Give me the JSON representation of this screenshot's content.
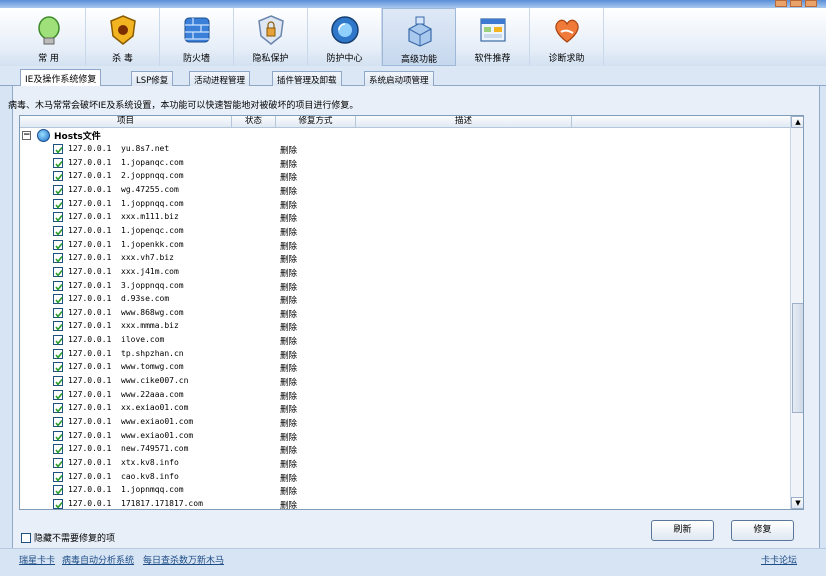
{
  "toolbar": {
    "items": [
      {
        "label": "常  用",
        "icon": "bulb-icon"
      },
      {
        "label": "杀  毒",
        "icon": "shield-bug-icon"
      },
      {
        "label": "防火墙",
        "icon": "firewall-icon"
      },
      {
        "label": "隐私保护",
        "icon": "lock-shield-icon"
      },
      {
        "label": "防护中心",
        "icon": "protection-globe-icon"
      },
      {
        "label": "高级功能",
        "icon": "advanced-blocks-icon"
      },
      {
        "label": "软件推荐",
        "icon": "software-window-icon"
      },
      {
        "label": "诊断求助",
        "icon": "heart-help-icon"
      }
    ],
    "active_index": 5
  },
  "tabs": [
    "IE及操作系统修复",
    "LSP修复",
    "活动进程管理",
    "插件管理及卸载",
    "系统启动项管理"
  ],
  "active_tab": 0,
  "description": "病毒、木马常常会破坏IE及系统设置，本功能可以快速智能地对被破坏的项目进行修复。",
  "grid": {
    "columns": [
      "项目",
      "状态",
      "修复方式",
      "描述"
    ],
    "group_label": "Hosts文件",
    "fix_method": "删除",
    "rows": [
      {
        "ip": "127.0.0.1",
        "host": "yu.8s7.net"
      },
      {
        "ip": "127.0.0.1",
        "host": "1.jopanqc.com"
      },
      {
        "ip": "127.0.0.1",
        "host": "2.joppnqq.com"
      },
      {
        "ip": "127.0.0.1",
        "host": "wg.47255.com"
      },
      {
        "ip": "127.0.0.1",
        "host": "1.joppnqq.com"
      },
      {
        "ip": "127.0.0.1",
        "host": "xxx.m111.biz"
      },
      {
        "ip": "127.0.0.1",
        "host": "1.jopenqc.com"
      },
      {
        "ip": "127.0.0.1",
        "host": "1.jopenkk.com"
      },
      {
        "ip": "127.0.0.1",
        "host": "xxx.vh7.biz"
      },
      {
        "ip": "127.0.0.1",
        "host": "xxx.j41m.com"
      },
      {
        "ip": "127.0.0.1",
        "host": "3.joppnqq.com"
      },
      {
        "ip": "127.0.0.1",
        "host": "d.93se.com"
      },
      {
        "ip": "127.0.0.1",
        "host": "www.868wg.com"
      },
      {
        "ip": "127.0.0.1",
        "host": "xxx.mmma.biz"
      },
      {
        "ip": "127.0.0.1",
        "host": "ilove.com"
      },
      {
        "ip": "127.0.0.1",
        "host": "tp.shpzhan.cn"
      },
      {
        "ip": "127.0.0.1",
        "host": "www.tomwg.com"
      },
      {
        "ip": "127.0.0.1",
        "host": "www.cike007.cn"
      },
      {
        "ip": "127.0.0.1",
        "host": "www.22aaa.com"
      },
      {
        "ip": "127.0.0.1",
        "host": "xx.exiao01.com"
      },
      {
        "ip": "127.0.0.1",
        "host": "www.exiao01.com"
      },
      {
        "ip": "127.0.0.1",
        "host": "www.exiao01.com"
      },
      {
        "ip": "127.0.0.1",
        "host": "new.749571.com"
      },
      {
        "ip": "127.0.0.1",
        "host": "xtx.kv8.info"
      },
      {
        "ip": "127.0.0.1",
        "host": "cao.kv8.info"
      },
      {
        "ip": "127.0.0.1",
        "host": "1.jopnmqq.com"
      },
      {
        "ip": "127.0.0.1",
        "host": "171817.171817.com"
      }
    ]
  },
  "hide_checkbox_label": "隐藏不需要修复的项",
  "buttons": {
    "refresh": "刷新",
    "repair": "修复"
  },
  "footer": {
    "links": [
      "瑞星卡卡",
      "病毒自动分析系统",
      "每日查杀数万新木马"
    ],
    "forum": "卡卡论坛"
  },
  "colors": {
    "accent": "#1c5180",
    "check": "#2a9a2a",
    "panel": "#e8eff8"
  }
}
